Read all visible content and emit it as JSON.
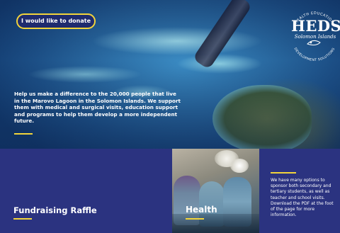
{
  "header": {
    "donate_label": "I would like to donate"
  },
  "logo": {
    "wordmark": "HEDS",
    "location": "Solomon Islands",
    "ring_top": "HEALTH EDUCATION",
    "ring_bottom": "DEVELOPMENT SOLUTIONS"
  },
  "hero": {
    "text": "Help us make a difference to the 20,000 people that live in the Marovo Lagoon in the Solomon Islands. We support them with medical and surgical visits, education support and programs to help them develop a more independent future."
  },
  "panels": {
    "raffle_title": "Fundraising Raffle",
    "health_title": "Health",
    "info_text": "We have many options to sponsor both secondary and tertiary students, as well as teacher and school visits. Download the PDF at the foot of the page for more information."
  },
  "colors": {
    "accent": "#f2d43b",
    "navy": "#2b3380"
  }
}
